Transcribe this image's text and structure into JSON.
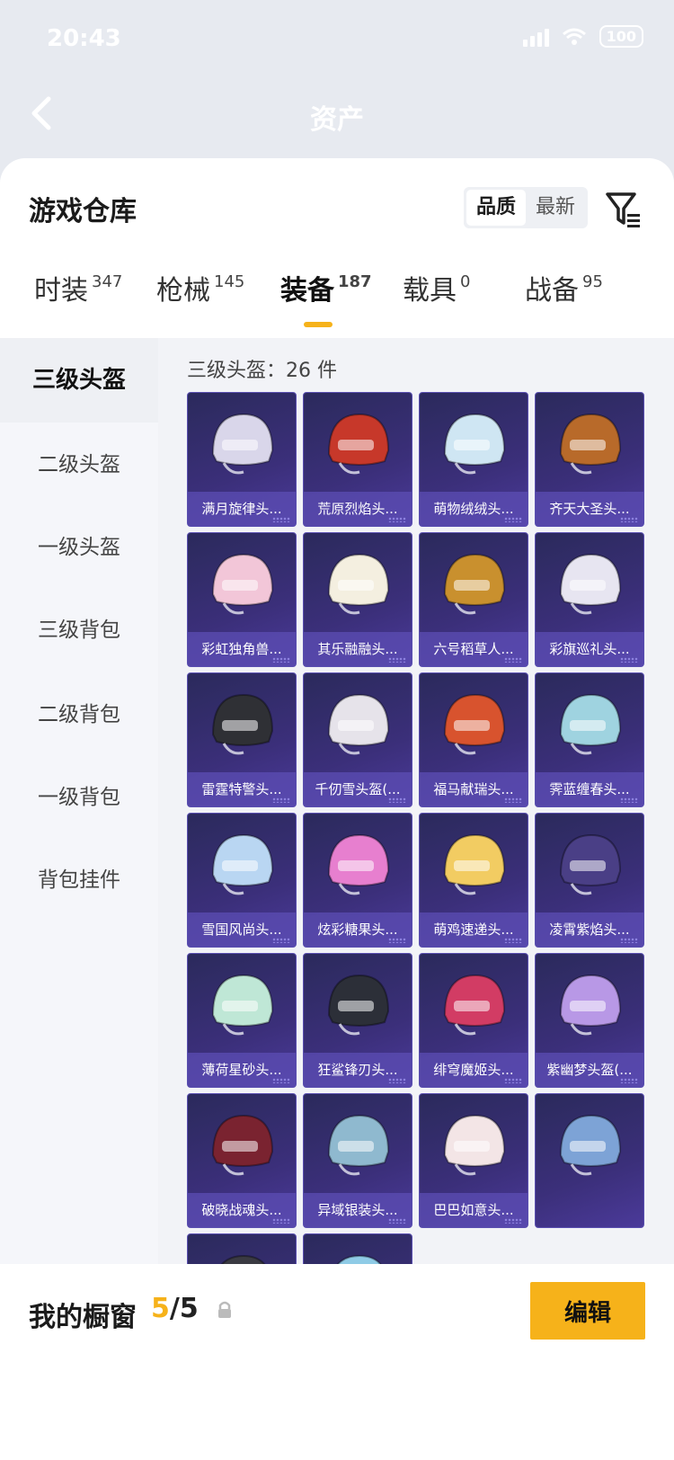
{
  "status": {
    "time": "20:43",
    "battery": "100"
  },
  "nav": {
    "title": "资产"
  },
  "sheet": {
    "title": "游戏仓库",
    "sort_options": [
      "品质",
      "最新"
    ],
    "sort_selected": "品质"
  },
  "tabs": [
    {
      "label": "时装",
      "count": "347"
    },
    {
      "label": "枪械",
      "count": "145"
    },
    {
      "label": "装备",
      "count": "187",
      "active": true
    },
    {
      "label": "载具",
      "count": "0"
    },
    {
      "label": "战备",
      "count": "95"
    }
  ],
  "categories": [
    {
      "label": "三级头盔",
      "active": true
    },
    {
      "label": "二级头盔"
    },
    {
      "label": "一级头盔"
    },
    {
      "label": "三级背包"
    },
    {
      "label": "二级背包"
    },
    {
      "label": "一级背包"
    },
    {
      "label": "背包挂件"
    }
  ],
  "content": {
    "count_text": "三级头盔：26 件"
  },
  "items": [
    {
      "name": "满月旋律头...",
      "color": "#d9d6ea"
    },
    {
      "name": "荒原烈焰头...",
      "color": "#c7382a"
    },
    {
      "name": "萌物绒绒头...",
      "color": "#cfe6f3"
    },
    {
      "name": "齐天大圣头...",
      "color": "#b86a2a"
    },
    {
      "name": "彩虹独角兽...",
      "color": "#f2c6d8"
    },
    {
      "name": "其乐融融头...",
      "color": "#f4efe0"
    },
    {
      "name": "六号稻草人...",
      "color": "#c9902e"
    },
    {
      "name": "彩旗巡礼头...",
      "color": "#e7e5f1"
    },
    {
      "name": "雷霆特警头...",
      "color": "#2f3035"
    },
    {
      "name": "千仞雪头盔(...",
      "color": "#e6e3ea"
    },
    {
      "name": "福马献瑞头...",
      "color": "#d8532e"
    },
    {
      "name": "霁蓝缠春头...",
      "color": "#9fd3e0"
    },
    {
      "name": "雪国风尚头...",
      "color": "#b9d6f2"
    },
    {
      "name": "炫彩糖果头...",
      "color": "#e77fcf"
    },
    {
      "name": "萌鸡速递头...",
      "color": "#f2cc62"
    },
    {
      "name": "凌霄紫焰头...",
      "color": "#4a3f86"
    },
    {
      "name": "薄荷星砂头...",
      "color": "#bfe7d6"
    },
    {
      "name": "狂鲨锋刃头...",
      "color": "#2c2f38"
    },
    {
      "name": "绯穹魔姬头...",
      "color": "#d23c64"
    },
    {
      "name": "紫幽梦头盔(...",
      "color": "#b898e6"
    },
    {
      "name": "破晓战魂头...",
      "color": "#7a2330"
    },
    {
      "name": "异域银装头...",
      "color": "#8fb9cf"
    },
    {
      "name": "巴巴如意头...",
      "color": "#f3e5e6"
    },
    {
      "name": "",
      "color": "#7da3d6"
    },
    {
      "name": "",
      "color": "#3a3a42"
    },
    {
      "name": "",
      "color": "#8fcbe6"
    }
  ],
  "showcase": {
    "label": "我的橱窗",
    "current": "5",
    "total": "/5",
    "edit_label": "编辑"
  },
  "icons": {
    "back": "chevron-left-icon",
    "filter": "filter-icon",
    "share": "share-external-icon",
    "lock": "lock-icon"
  }
}
